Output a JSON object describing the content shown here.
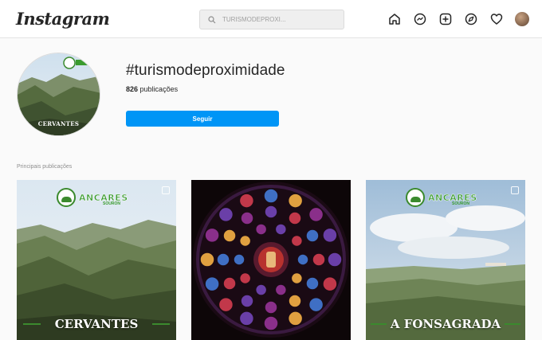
{
  "header": {
    "logo": "Instagram",
    "search_placeholder": "TURISMODEPROXI..."
  },
  "nav_icons": [
    "home-icon",
    "messenger-icon",
    "new-post-icon",
    "explore-icon",
    "heart-icon",
    "profile-avatar"
  ],
  "profile": {
    "picture_caption": "CERVANTES",
    "picture_brand_big": "ANCARES",
    "hashtag": "#turismodeproximidade",
    "posts_count": "826",
    "posts_label": "publicações",
    "follow_label": "Seguir"
  },
  "section": {
    "label": "Principais publicações"
  },
  "posts": [
    {
      "brand_big": "ANCARES",
      "brand_sub": "SOURON",
      "place": "CERVANTES"
    },
    {
      "brand_big": "",
      "brand_sub": "",
      "place": ""
    },
    {
      "brand_big": "ANCARES",
      "brand_sub": "SOURON",
      "place": "A FONSAGRADA"
    }
  ],
  "colors": {
    "accent": "#0095f6",
    "brand_green": "#3b8a2e",
    "background": "#fafafa"
  }
}
